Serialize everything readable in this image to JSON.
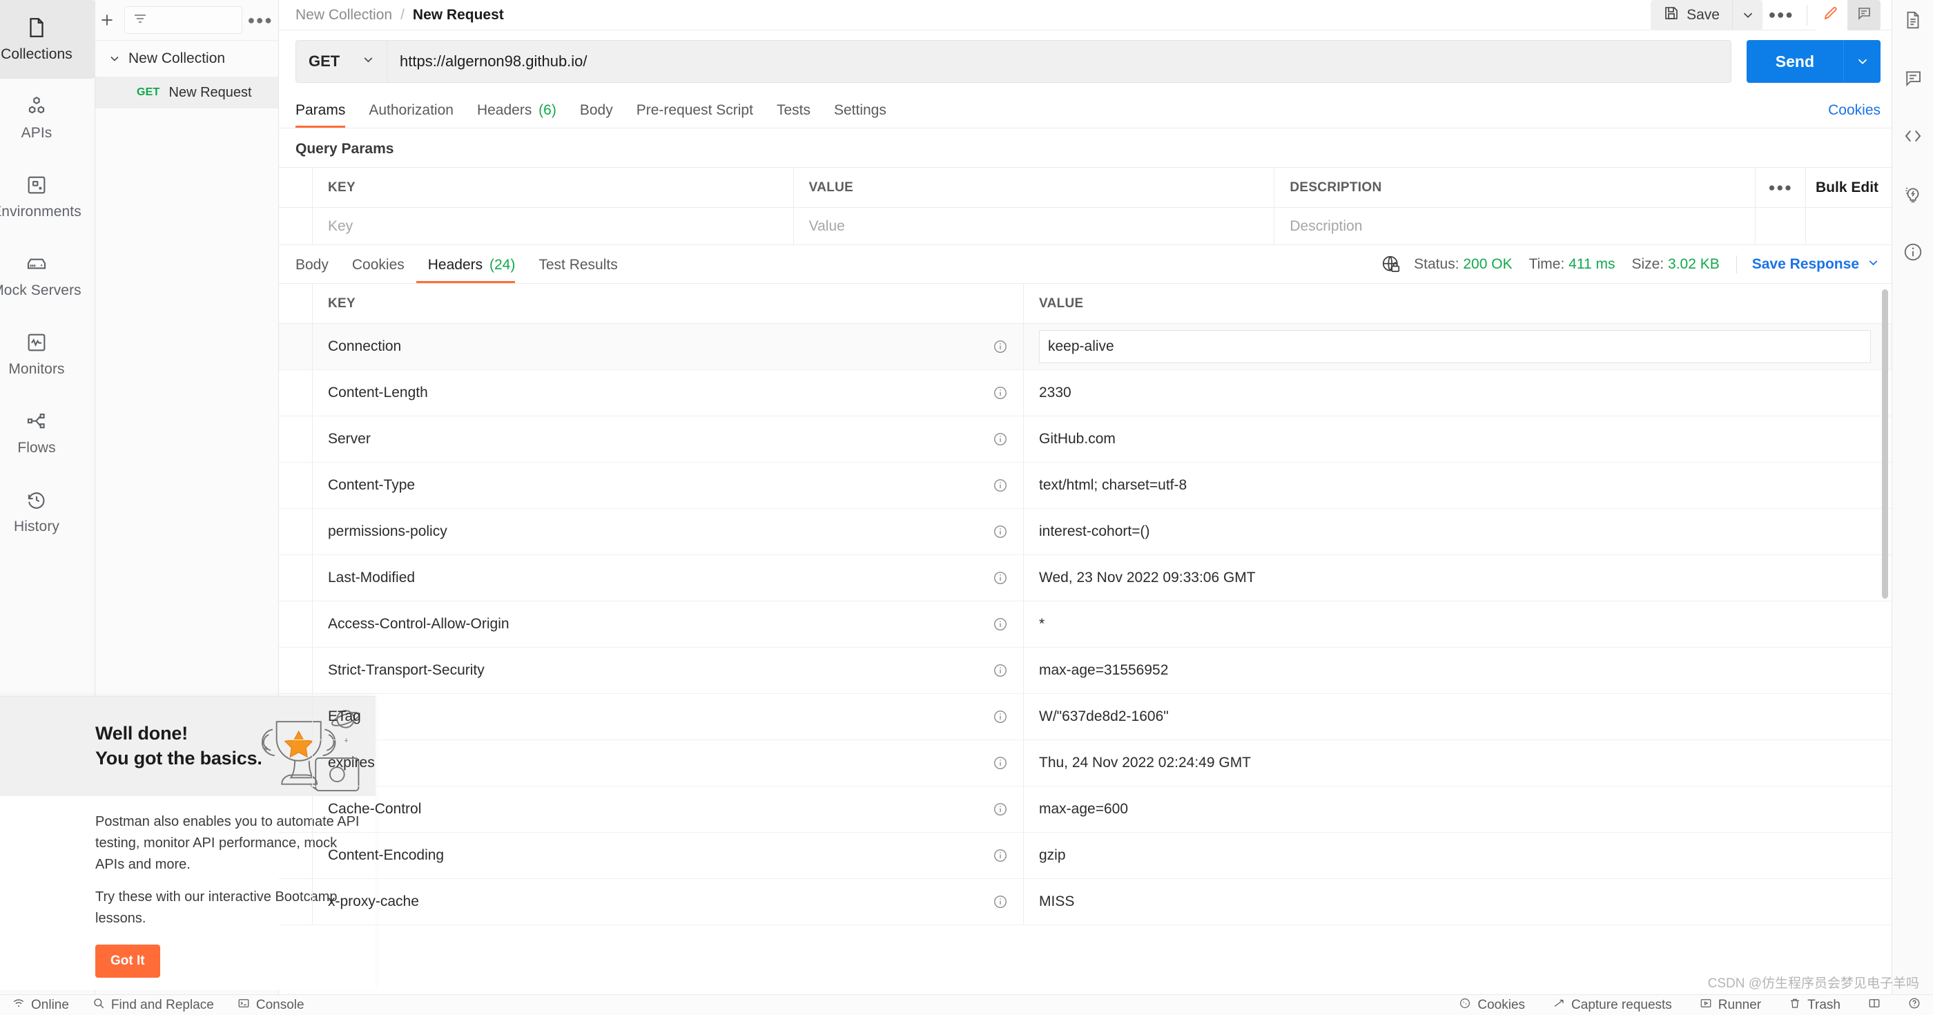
{
  "rail": {
    "items": [
      {
        "label": "Collections",
        "icon": "collections-icon",
        "active": true
      },
      {
        "label": "APIs",
        "icon": "apis-icon",
        "active": false
      },
      {
        "label": "Environments",
        "icon": "environments-icon",
        "active": false
      },
      {
        "label": "Mock Servers",
        "icon": "mock-servers-icon",
        "active": false
      },
      {
        "label": "Monitors",
        "icon": "monitors-icon",
        "active": false
      },
      {
        "label": "Flows",
        "icon": "flows-icon",
        "active": false
      },
      {
        "label": "History",
        "icon": "history-icon",
        "active": false
      }
    ]
  },
  "sidebar": {
    "new_button": "+",
    "filter_placeholder": "",
    "more_label": "●●●",
    "collection_name": "New Collection",
    "request": {
      "method": "GET",
      "name": "New Request"
    }
  },
  "promo": {
    "title_line1": "Well done!",
    "title_line2": "You got the basics.",
    "body1": "Postman also enables you to automate API testing, monitor API performance, mock APIs and more.",
    "body2": "Try these with our interactive Bootcamp lessons.",
    "cta": "Got It",
    "accent": "#ff6c37"
  },
  "request_header": {
    "breadcrumb_collection": "New Collection",
    "breadcrumb_sep": "/",
    "breadcrumb_request": "New Request",
    "save_label": "Save",
    "more_label": "●●●",
    "edit_icon": "pencil-icon",
    "comment_icon": "comment-icon"
  },
  "url_bar": {
    "method": "GET",
    "url": "https://algernon98.github.io/",
    "send_label": "Send"
  },
  "request_tabs": {
    "tabs": [
      {
        "label": "Params",
        "count": "",
        "active": true
      },
      {
        "label": "Authorization",
        "count": "",
        "active": false
      },
      {
        "label": "Headers",
        "count": "(6)",
        "active": false
      },
      {
        "label": "Body",
        "count": "",
        "active": false
      },
      {
        "label": "Pre-request Script",
        "count": "",
        "active": false
      },
      {
        "label": "Tests",
        "count": "",
        "active": false
      },
      {
        "label": "Settings",
        "count": "",
        "active": false
      }
    ],
    "cookies_link": "Cookies"
  },
  "query_params": {
    "section_title": "Query Params",
    "columns": [
      "KEY",
      "VALUE",
      "DESCRIPTION"
    ],
    "more_label": "●●●",
    "bulk_edit": "Bulk Edit",
    "row_placeholders": {
      "key": "Key",
      "value": "Value",
      "description": "Description"
    }
  },
  "response": {
    "tabs": [
      {
        "label": "Body",
        "count": "",
        "active": false
      },
      {
        "label": "Cookies",
        "count": "",
        "active": false
      },
      {
        "label": "Headers",
        "count": "(24)",
        "active": true
      },
      {
        "label": "Test Results",
        "count": "",
        "active": false
      }
    ],
    "globe_icon": "globe-lock-icon",
    "status_label": "Status:",
    "status_value": "200 OK",
    "time_label": "Time:",
    "time_value": "411 ms",
    "size_label": "Size:",
    "size_value": "3.02 KB",
    "save_response": "Save Response",
    "ok_color": "#11a84c",
    "link_color": "#1a73e8",
    "columns": [
      "KEY",
      "VALUE"
    ],
    "headers": [
      {
        "key": "Connection",
        "value": "keep-alive"
      },
      {
        "key": "Content-Length",
        "value": "2330"
      },
      {
        "key": "Server",
        "value": "GitHub.com"
      },
      {
        "key": "Content-Type",
        "value": "text/html; charset=utf-8"
      },
      {
        "key": "permissions-policy",
        "value": "interest-cohort=()"
      },
      {
        "key": "Last-Modified",
        "value": "Wed, 23 Nov 2022 09:33:06 GMT"
      },
      {
        "key": "Access-Control-Allow-Origin",
        "value": "*"
      },
      {
        "key": "Strict-Transport-Security",
        "value": "max-age=31556952"
      },
      {
        "key": "ETag",
        "value": "W/\"637de8d2-1606\""
      },
      {
        "key": "expires",
        "value": "Thu, 24 Nov 2022 02:24:49 GMT"
      },
      {
        "key": "Cache-Control",
        "value": "max-age=600"
      },
      {
        "key": "Content-Encoding",
        "value": "gzip"
      },
      {
        "key": "x-proxy-cache",
        "value": "MISS"
      }
    ]
  },
  "right_rail": {
    "items": [
      {
        "icon": "documentation-icon"
      },
      {
        "icon": "comment-icon"
      },
      {
        "icon": "code-icon"
      },
      {
        "icon": "lightbulb-icon"
      },
      {
        "icon": "info-circle-icon"
      }
    ]
  },
  "status_bar": {
    "left": [
      {
        "label": "Online",
        "icon": "wifi-icon"
      },
      {
        "label": "Find and Replace",
        "icon": "search-icon"
      },
      {
        "label": "Console",
        "icon": "terminal-icon"
      }
    ],
    "right": [
      {
        "label": "Cookies",
        "icon": "cookie-icon"
      },
      {
        "label": "Capture requests",
        "icon": "capture-icon"
      },
      {
        "label": "Runner",
        "icon": "runner-icon"
      },
      {
        "label": "Trash",
        "icon": "trash-icon"
      },
      {
        "label": "",
        "icon": "layout-icon"
      },
      {
        "label": "",
        "icon": "help-icon"
      }
    ]
  },
  "watermark": "CSDN @仿生程序员会梦见电子羊吗"
}
